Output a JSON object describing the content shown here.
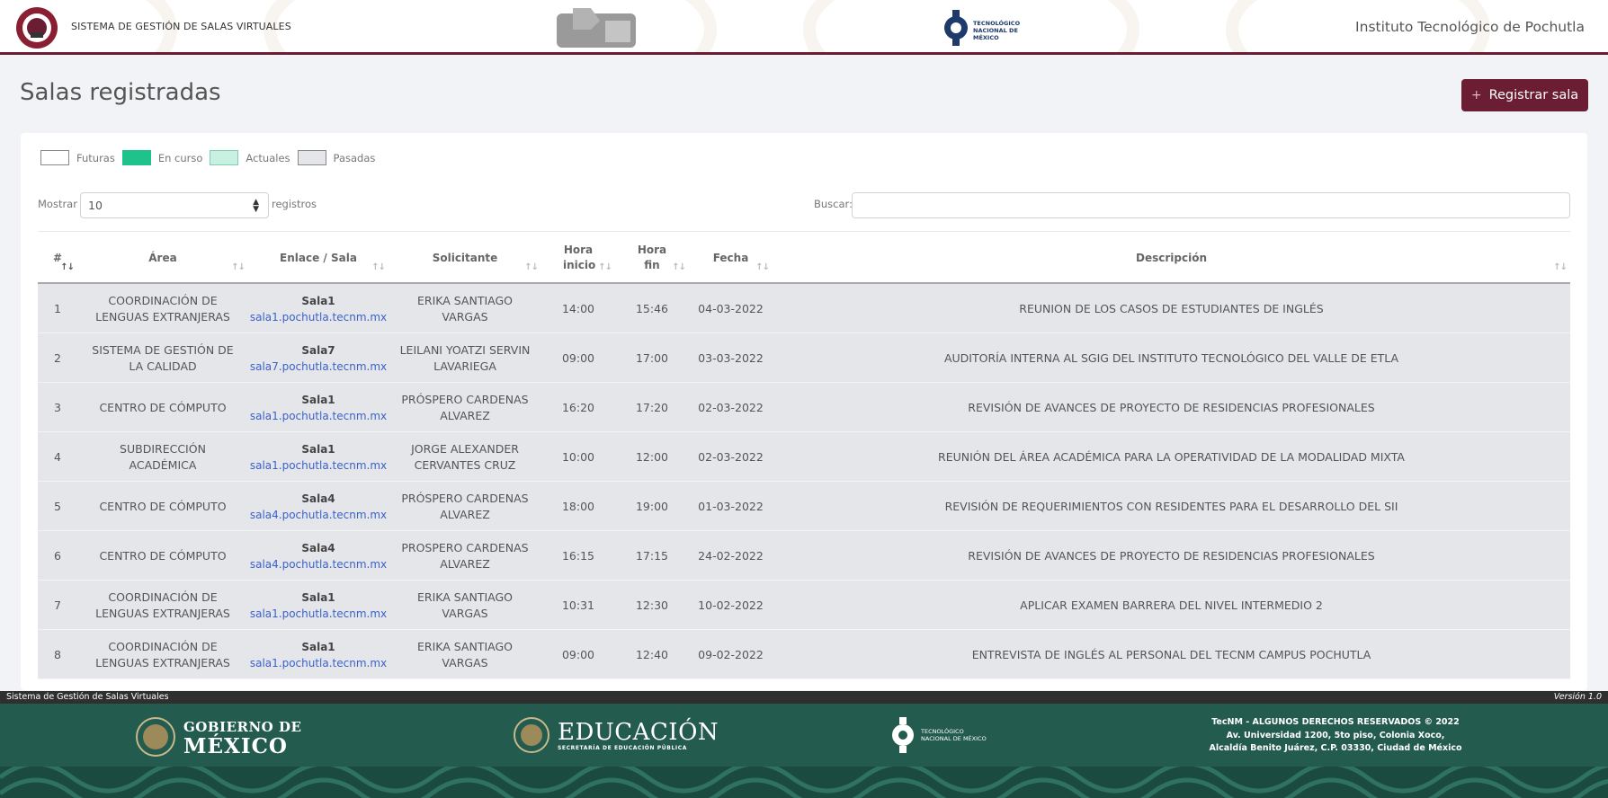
{
  "header": {
    "app_name": "SISTEMA DE GESTIÓN DE SALAS VIRTUALES",
    "institution": "Instituto Tecnológico de Pochutla",
    "tecnm_line1": "TECNOLÓGICO",
    "tecnm_line2": "NACIONAL DE MÉXICO",
    "brand_color": "#6b1d33"
  },
  "page": {
    "title": "Salas registradas",
    "register_button": "Registrar sala",
    "register_icon": "+"
  },
  "legend": [
    {
      "label": "Futuras",
      "color": "#ffffff"
    },
    {
      "label": "En curso",
      "color": "#1fc28a"
    },
    {
      "label": "Actuales",
      "color": "#c9f1e2"
    },
    {
      "label": "Pasadas",
      "color": "#e5e6e9"
    }
  ],
  "controls": {
    "show_label": "Mostrar",
    "page_length": "10",
    "records_label": "registros",
    "search_label": "Buscar:",
    "search_value": ""
  },
  "table": {
    "columns": [
      "#",
      "Área",
      "Enlace / Sala",
      "Solicitante",
      "Hora inicio",
      "Hora fin",
      "Fecha",
      "Descripción"
    ],
    "rows": [
      {
        "num": "1",
        "area": "COORDINACIÓN DE LENGUAS EXTRANJERAS",
        "room": "Sala1",
        "link": "sala1.pochutla.tecnm.mx",
        "requester": "ERIKA SANTIAGO VARGAS",
        "start": "14:00",
        "end": "15:46",
        "date": "04-03-2022",
        "description": "REUNION DE LOS CASOS DE ESTUDIANTES DE INGLÉS"
      },
      {
        "num": "2",
        "area": "SISTEMA DE GESTIÓN DE LA CALIDAD",
        "room": "Sala7",
        "link": "sala7.pochutla.tecnm.mx",
        "requester": "LEILANI YOATZI SERVIN LAVARIEGA",
        "start": "09:00",
        "end": "17:00",
        "date": "03-03-2022",
        "description": "AUDITORÍA INTERNA AL SGIG DEL INSTITUTO TECNOLÓGICO DEL VALLE DE ETLA"
      },
      {
        "num": "3",
        "area": "CENTRO DE CÓMPUTO",
        "room": "Sala1",
        "link": "sala1.pochutla.tecnm.mx",
        "requester": "PRÓSPERO CARDENAS ALVAREZ",
        "start": "16:20",
        "end": "17:20",
        "date": "02-03-2022",
        "description": "REVISIÓN DE AVANCES DE PROYECTO DE RESIDENCIAS PROFESIONALES"
      },
      {
        "num": "4",
        "area": "SUBDIRECCIÓN ACADÉMICA",
        "room": "Sala1",
        "link": "sala1.pochutla.tecnm.mx",
        "requester": "JORGE ALEXANDER CERVANTES CRUZ",
        "start": "10:00",
        "end": "12:00",
        "date": "02-03-2022",
        "description": "REUNIÓN DEL ÁREA ACADÉMICA PARA LA OPERATIVIDAD DE LA MODALIDAD MIXTA"
      },
      {
        "num": "5",
        "area": "CENTRO DE CÓMPUTO",
        "room": "Sala4",
        "link": "sala4.pochutla.tecnm.mx",
        "requester": "PRÓSPERO CARDENAS ALVAREZ",
        "start": "18:00",
        "end": "19:00",
        "date": "01-03-2022",
        "description": "REVISIÓN DE REQUERIMIENTOS CON RESIDENTES PARA EL DESARROLLO DEL SII"
      },
      {
        "num": "6",
        "area": "CENTRO DE CÓMPUTO",
        "room": "Sala4",
        "link": "sala4.pochutla.tecnm.mx",
        "requester": "PROSPERO CARDENAS ALVAREZ",
        "start": "16:15",
        "end": "17:15",
        "date": "24-02-2022",
        "description": "REVISIÓN DE AVANCES DE PROYECTO DE RESIDENCIAS PROFESIONALES"
      },
      {
        "num": "7",
        "area": "COORDINACIÓN DE LENGUAS EXTRANJERAS",
        "room": "Sala1",
        "link": "sala1.pochutla.tecnm.mx",
        "requester": "ERIKA SANTIAGO VARGAS",
        "start": "10:31",
        "end": "12:30",
        "date": "10-02-2022",
        "description": "APLICAR EXAMEN BARRERA DEL NIVEL INTERMEDIO 2"
      },
      {
        "num": "8",
        "area": "COORDINACIÓN DE LENGUAS EXTRANJERAS",
        "room": "Sala1",
        "link": "sala1.pochutla.tecnm.mx",
        "requester": "ERIKA SANTIAGO VARGAS",
        "start": "09:00",
        "end": "12:40",
        "date": "09-02-2022",
        "description": "ENTREVISTA DE INGLÉS AL PERSONAL DEL TECNM CAMPUS POCHUTLA"
      }
    ]
  },
  "footer": {
    "system_name": "Sistema de Gestión de Salas Virtuales",
    "version": "Versión 1.0",
    "gob_line1": "GOBIERNO DE",
    "gob_line2": "MÉXICO",
    "edu_line1": "EDUCACIÓN",
    "edu_line2": "SECRETARÍA DE EDUCACIÓN PÚBLICA",
    "tecnm_line1": "TECNOLÓGICO",
    "tecnm_line2": "NACIONAL DE MÉXICO",
    "copyright": "TecNM - ALGUNOS DERECHOS RESERVADOS © 2022",
    "address1": "Av. Universidad 1200, 5to piso, Colonia Xoco,",
    "address2": "Alcaldía Benito Juárez, C.P. 03330, Ciudad de México",
    "bg_color": "#235b4e"
  }
}
